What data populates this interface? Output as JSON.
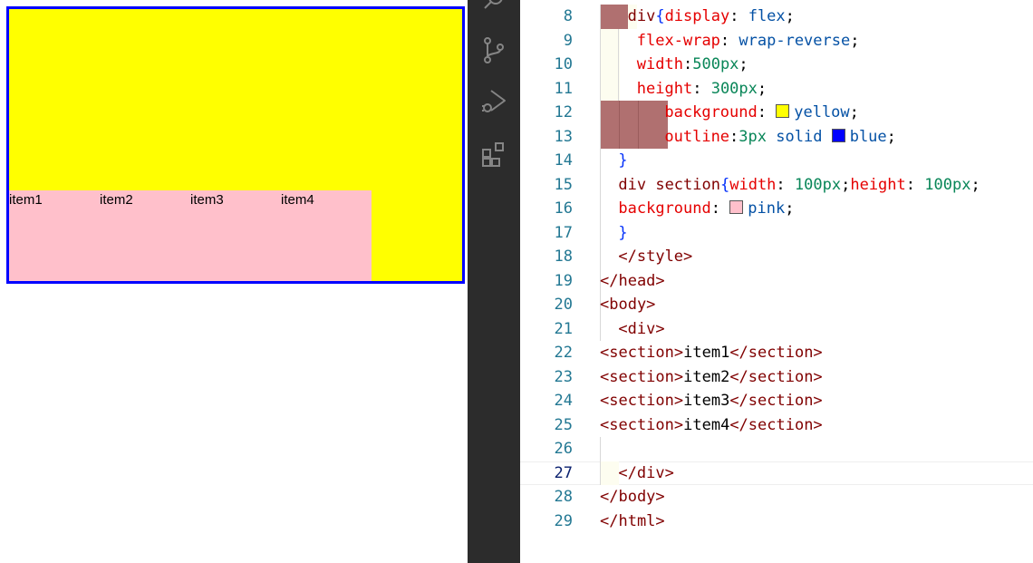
{
  "preview": {
    "box_color": "#ffff00",
    "outline_color": "#0000ff",
    "item_color": "#ffc0cb",
    "items": [
      "item1",
      "item2",
      "item3",
      "item4"
    ]
  },
  "activity_bar": {
    "icons": [
      "search-icon",
      "source-control-icon",
      "run-debug-icon",
      "extensions-icon"
    ]
  },
  "editor": {
    "current_line": "27",
    "lines": [
      {
        "num": "8",
        "tokens": [
          {
            "t": "div",
            "c": "p"
          },
          {
            "t": "{",
            "c": "b"
          },
          {
            "t": "display",
            "c": "k"
          },
          {
            "t": ": ",
            "c": "d"
          },
          {
            "t": "flex",
            "c": "v"
          },
          {
            "t": ";",
            "c": "d"
          }
        ]
      },
      {
        "num": "9",
        "tokens": [
          {
            "t": "flex-wrap",
            "c": "k"
          },
          {
            "t": ": ",
            "c": "d"
          },
          {
            "t": "wrap-reverse",
            "c": "v"
          },
          {
            "t": ";",
            "c": "d"
          }
        ]
      },
      {
        "num": "10",
        "tokens": [
          {
            "t": "width",
            "c": "k"
          },
          {
            "t": ":",
            "c": "d"
          },
          {
            "t": "500px",
            "c": "n"
          },
          {
            "t": ";",
            "c": "d"
          }
        ]
      },
      {
        "num": "11",
        "tokens": [
          {
            "t": "height",
            "c": "k"
          },
          {
            "t": ": ",
            "c": "d"
          },
          {
            "t": "300px",
            "c": "n"
          },
          {
            "t": ";",
            "c": "d"
          }
        ]
      },
      {
        "num": "12",
        "tokens": [
          {
            "t": "background",
            "c": "k"
          },
          {
            "t": ": ",
            "c": "d"
          },
          {
            "swatch": "#ffff00"
          },
          {
            "t": "yellow",
            "c": "v"
          },
          {
            "t": ";",
            "c": "d"
          }
        ]
      },
      {
        "num": "13",
        "tokens": [
          {
            "t": "outline",
            "c": "k"
          },
          {
            "t": ":",
            "c": "d"
          },
          {
            "t": "3px",
            "c": "n"
          },
          {
            "t": " ",
            "c": "d"
          },
          {
            "t": "solid",
            "c": "v"
          },
          {
            "t": " ",
            "c": "d"
          },
          {
            "swatch": "#0000ff"
          },
          {
            "t": "blue",
            "c": "v"
          },
          {
            "t": ";",
            "c": "d"
          }
        ]
      },
      {
        "num": "14",
        "tokens": [
          {
            "t": "}",
            "c": "b"
          }
        ]
      },
      {
        "num": "15",
        "tokens": [
          {
            "t": "div section",
            "c": "p"
          },
          {
            "t": "{",
            "c": "b"
          },
          {
            "t": "width",
            "c": "k"
          },
          {
            "t": ": ",
            "c": "d"
          },
          {
            "t": "100px",
            "c": "n"
          },
          {
            "t": ";",
            "c": "d"
          },
          {
            "t": "height",
            "c": "k"
          },
          {
            "t": ": ",
            "c": "d"
          },
          {
            "t": "100px",
            "c": "n"
          },
          {
            "t": ";",
            "c": "d"
          }
        ]
      },
      {
        "num": "16",
        "tokens": [
          {
            "t": "background",
            "c": "k"
          },
          {
            "t": ": ",
            "c": "d"
          },
          {
            "swatch": "#ffc0cb"
          },
          {
            "t": "pink",
            "c": "v"
          },
          {
            "t": ";",
            "c": "d"
          }
        ]
      },
      {
        "num": "17",
        "tokens": [
          {
            "t": "}",
            "c": "b"
          }
        ]
      },
      {
        "num": "18",
        "tokens": [
          {
            "t": "</style>",
            "c": "p"
          }
        ]
      },
      {
        "num": "19",
        "tokens": [
          {
            "t": "</head>",
            "c": "p"
          }
        ]
      },
      {
        "num": "20",
        "tokens": [
          {
            "t": "<body>",
            "c": "p"
          }
        ]
      },
      {
        "num": "21",
        "tokens": [
          {
            "t": "<div>",
            "c": "p"
          }
        ]
      },
      {
        "num": "22",
        "tokens": [
          {
            "t": "<section>",
            "c": "p"
          },
          {
            "t": "item1",
            "c": "d"
          },
          {
            "t": "</section>",
            "c": "p"
          }
        ]
      },
      {
        "num": "23",
        "tokens": [
          {
            "t": "<section>",
            "c": "p"
          },
          {
            "t": "item2",
            "c": "d"
          },
          {
            "t": "</section>",
            "c": "p"
          }
        ]
      },
      {
        "num": "24",
        "tokens": [
          {
            "t": "<section>",
            "c": "p"
          },
          {
            "t": "item3",
            "c": "d"
          },
          {
            "t": "</section>",
            "c": "p"
          }
        ]
      },
      {
        "num": "25",
        "tokens": [
          {
            "t": "<section>",
            "c": "p"
          },
          {
            "t": "item4",
            "c": "d"
          },
          {
            "t": "</section>",
            "c": "p"
          }
        ]
      },
      {
        "num": "26",
        "tokens": []
      },
      {
        "num": "27",
        "tokens": [
          {
            "t": "</div>",
            "c": "p"
          }
        ]
      },
      {
        "num": "28",
        "tokens": [
          {
            "t": "</body>",
            "c": "p"
          }
        ]
      },
      {
        "num": "29",
        "tokens": [
          {
            "t": "</html>",
            "c": "p"
          }
        ]
      }
    ]
  }
}
